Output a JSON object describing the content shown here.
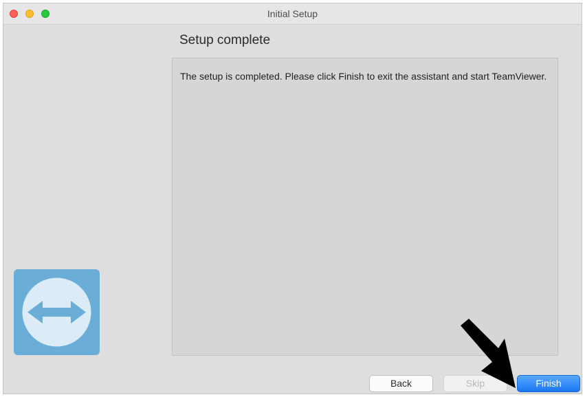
{
  "window": {
    "title": "Initial Setup"
  },
  "page": {
    "heading": "Setup complete",
    "message": "The setup is completed. Please click Finish to exit the assistant and start TeamViewer."
  },
  "buttons": {
    "back": "Back",
    "skip": "Skip",
    "finish": "Finish"
  },
  "icons": {
    "logo": "teamviewer-logo",
    "annotation": "arrow-pointer"
  },
  "colors": {
    "accent_blue": "#1877f2",
    "logo_background": "#6aaed8",
    "logo_arrow": "#6aaed8"
  }
}
